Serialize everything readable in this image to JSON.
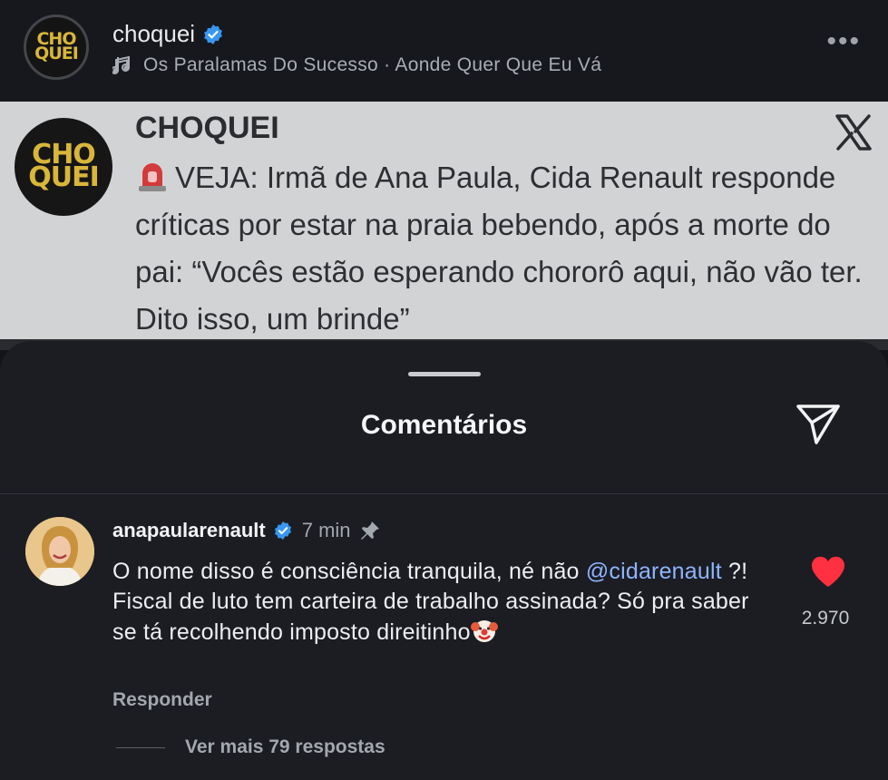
{
  "post": {
    "username": "choquei",
    "logo_text_line1": "CHO",
    "logo_text_line2": "QUEI",
    "music": "Os Paralamas Do Sucesso · Aonde Quer Que Eu Vá",
    "more_icon": "more-dots-icon"
  },
  "tweet": {
    "name": "CHOQUEI",
    "text": "VEJA: Irmã de Ana Paula, Cida Renault responde críticas por estar na praia bebendo, após a morte do pai: “Vocês estão esperando chororô aqui, não vão ter. Dito isso, um brinde”",
    "platform_icon": "x-logo-icon"
  },
  "comments_sheet": {
    "title": "Comentários",
    "share_icon": "send-icon",
    "comment": {
      "username": "anapaularenault",
      "time": "7 min",
      "text_before": "O nome disso é consciência tranquila, né não ",
      "mention": "@cidarenault",
      "text_after": " ?! Fiscal de luto tem carteira de trabalho assinada? Só pra saber se tá recolhendo imposto direitinho",
      "likes": "2.970",
      "reply_label": "Responder",
      "more_replies": "Ver mais 79 respostas"
    }
  },
  "colors": {
    "background": "#121419",
    "sheet": "#1b1d22",
    "verified": "#3897f0",
    "heart": "#ff3040",
    "logo_gold": "#d9b63a"
  }
}
